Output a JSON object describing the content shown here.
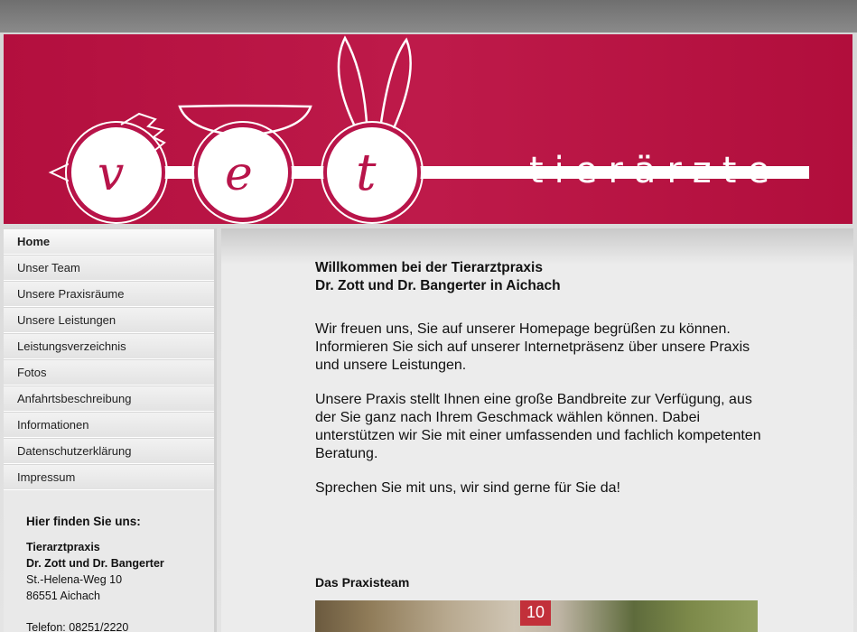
{
  "header": {
    "logo_letters": [
      "v",
      "e",
      "t"
    ],
    "logo_text": "tierärzte",
    "brand_color": "#b8144a"
  },
  "nav": {
    "items": [
      {
        "label": "Home",
        "active": true
      },
      {
        "label": "Unser Team"
      },
      {
        "label": "Unsere Praxisräume"
      },
      {
        "label": "Unsere Leistungen"
      },
      {
        "label": "Leistungsverzeichnis"
      },
      {
        "label": "Fotos"
      },
      {
        "label": "Anfahrtsbeschreibung"
      },
      {
        "label": "Informationen"
      },
      {
        "label": "Datenschutzerklärung"
      },
      {
        "label": "Impressum"
      }
    ]
  },
  "contact": {
    "heading": "Hier finden Sie uns:",
    "name1": "Tierarztpraxis",
    "name2": "Dr. Zott und Dr. Bangerter",
    "street": "St.-Helena-Weg 10",
    "city": "86551 Aichach",
    "phone": "Telefon: 08251/2220"
  },
  "main": {
    "welcome_line1": "Willkommen bei der Tierarztpraxis",
    "welcome_line2": "Dr. Zott und Dr. Bangerter in Aichach",
    "para1": "Wir freuen uns, Sie auf unserer Homepage begrüßen zu können. Informieren Sie sich auf unserer Internetpräsenz über unsere Praxis und unsere Leistungen.",
    "para2": "Unsere Praxis stellt  Ihnen eine große Bandbreite zur Verfügung, aus der Sie ganz nach Ihrem Geschmack wählen können. Dabei unterstützen wir Sie mit einer umfassenden und fachlich kompetenten Beratung.",
    "para3": "Sprechen Sie mit uns, wir sind gerne für Sie da!",
    "team_title": "Das Praxisteam",
    "photo_sign": "10"
  }
}
